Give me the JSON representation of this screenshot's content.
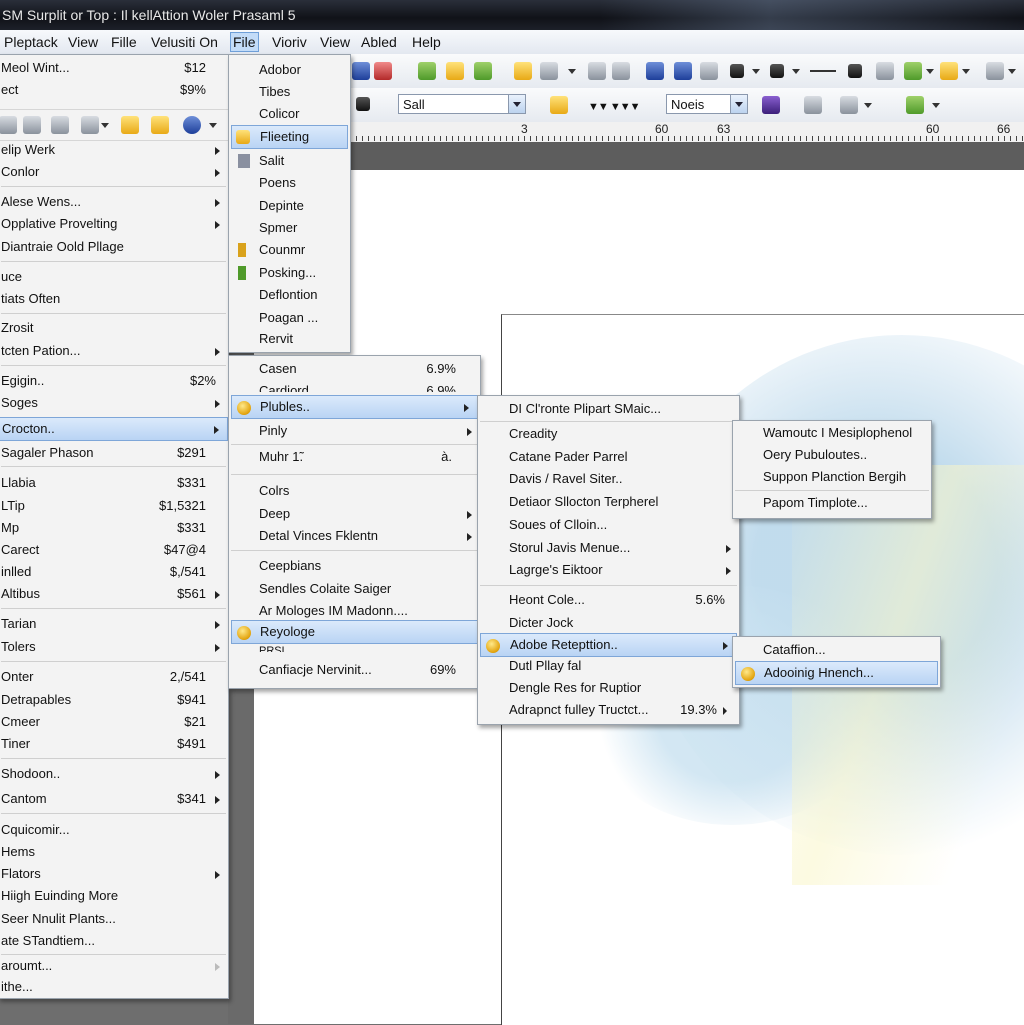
{
  "window": {
    "title": "SM Surplit or Top : Il kellAttion Woler Prasaml  5"
  },
  "menubar": {
    "items": [
      "Pleptack",
      "View",
      "Fille",
      "Velusiti On",
      "File",
      "Vioriv",
      "View",
      "Abled",
      "Help"
    ],
    "active_index": 4
  },
  "toolbar": {
    "font_combo": "Sall",
    "style_combo": "Noeis"
  },
  "ruler": {
    "labels": [
      "3",
      "60",
      "63",
      "60",
      "66"
    ]
  },
  "left_menu": {
    "items": [
      {
        "label": "Meol Wint...",
        "value": "$12"
      },
      {
        "label": "ect",
        "value": "$9%"
      },
      {
        "label": "elip Werk"
      },
      {
        "label": "Conlor"
      },
      {
        "label": "Alese Wens..."
      },
      {
        "label": "Opplative Provelting"
      },
      {
        "label": "Diantraie Oold Pllage"
      },
      {
        "label": "uce"
      },
      {
        "label": "tiats Often"
      },
      {
        "label": "Zrosit"
      },
      {
        "label": "tcten Pation..."
      },
      {
        "label": "Egigin..",
        "value": "$2%"
      },
      {
        "label": "Soges"
      },
      {
        "label": "Crocton.."
      },
      {
        "label": "Sagaler Phason",
        "value": "$291"
      },
      {
        "label": "Llabia",
        "value": "$331"
      },
      {
        "label": "LTip",
        "value": "$1,5321"
      },
      {
        "label": "Mp",
        "value": "$331"
      },
      {
        "label": "Carect",
        "value": "$47@4"
      },
      {
        "label": "inlled",
        "value": "$,/541"
      },
      {
        "label": "Altibus",
        "value": "$561"
      },
      {
        "label": "Tarian"
      },
      {
        "label": "Tolers"
      },
      {
        "label": "Onter",
        "value": "2,/541"
      },
      {
        "label": "Detrapables",
        "value": "$941"
      },
      {
        "label": "Cmeer",
        "value": "$21"
      },
      {
        "label": "Tiner",
        "value": "$491"
      },
      {
        "label": "Shodoon.."
      },
      {
        "label": "Cantom",
        "value": "$341"
      },
      {
        "label": "Cquicomir..."
      },
      {
        "label": "Hems"
      },
      {
        "label": "Flators"
      },
      {
        "label": "Hiigh Euinding More"
      },
      {
        "label": "Seer Nnulit Plants..."
      },
      {
        "label": "ate STandtiem..."
      },
      {
        "label": "aroumt..."
      },
      {
        "label": "ithe..."
      }
    ]
  },
  "file_menu": {
    "items": [
      "Adobor",
      "Tibes",
      "Colicor",
      "Flieeting",
      "Salit",
      "Poens",
      "Depinte",
      "Spmer",
      "Counmr",
      "Posking...",
      "Deflontion",
      "Poagan ...",
      "Rervit"
    ]
  },
  "sub1": {
    "items": [
      {
        "label": "Casen",
        "value": "6.9%"
      },
      {
        "label": "Cardiord",
        "value": "6.9%"
      },
      {
        "label": "Plubles.."
      },
      {
        "label": "Pinly"
      },
      {
        "label": "Muhr 1̃.",
        "value": "à."
      },
      {
        "label": "Colrs"
      },
      {
        "label": "Deep"
      },
      {
        "label": "Detal Vinces Fklentn"
      },
      {
        "label": "Ceepbians"
      },
      {
        "label": "Sendles Colaite Saiger"
      },
      {
        "label": "Ar Mologes IM Madonn...."
      },
      {
        "label": "Reyologe"
      },
      {
        "label": "PRSL"
      },
      {
        "label": "Canfiacje Nervinit...",
        "value": "69%"
      }
    ]
  },
  "sub2": {
    "items": [
      {
        "label": "DI Cl'ronte Plipart SMaic..."
      },
      {
        "label": "Creadity"
      },
      {
        "label": "Catane Pader Parrel"
      },
      {
        "label": "Davis / Ravel Siter.."
      },
      {
        "label": "Detiaor Sllocton Terpherel"
      },
      {
        "label": "Soues of Clloin..."
      },
      {
        "label": "Storul Javis Menue..."
      },
      {
        "label": "Lagrge's Eiktoor"
      },
      {
        "label": "Heont Cole...",
        "value": "5.6%"
      },
      {
        "label": "Dicter Jock"
      },
      {
        "label": "Adobe Retepttion.."
      },
      {
        "label": "Dutl Pllay fal"
      },
      {
        "label": "Dengle Res for Ruptior"
      },
      {
        "label": "Adrapnct fulley Tructct...",
        "value": "19.3%"
      }
    ]
  },
  "sub3": {
    "items": [
      "Wamoutc I Mesiplophenol",
      "Oery Pubuloutes..",
      "Suppon Planction Bergih",
      "Papom Timplote..."
    ]
  },
  "sub4": {
    "items": [
      "Cataffion...",
      "Adooinig Hnench..."
    ]
  }
}
